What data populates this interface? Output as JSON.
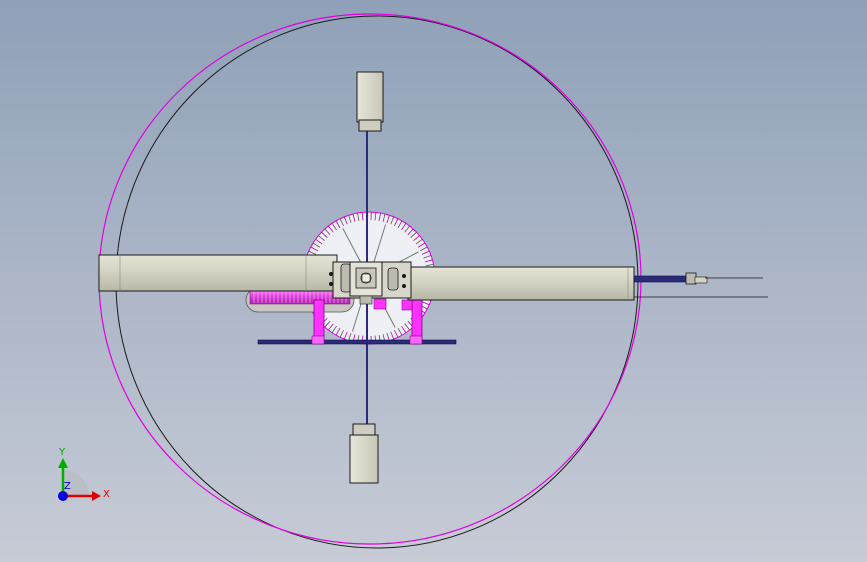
{
  "viewport": {
    "name": "CAD top view",
    "background_top": "#8fa0b8",
    "background_bottom": "#c7cbd6"
  },
  "colors": {
    "outline": "#1a1a1a",
    "highlight_magenta": "#e000e0",
    "shaft_blue": "#2b2b7a",
    "housing_fill": "#d6d4c4",
    "bracket_magenta": "#ff33ff",
    "axis_x": "#e00000",
    "axis_y": "#00b000",
    "axis_z": "#0000e0"
  },
  "triad": {
    "x_label": "X",
    "y_label": "Y",
    "z_label": "Z"
  },
  "icons": [
    "coordinate-triad-icon"
  ]
}
